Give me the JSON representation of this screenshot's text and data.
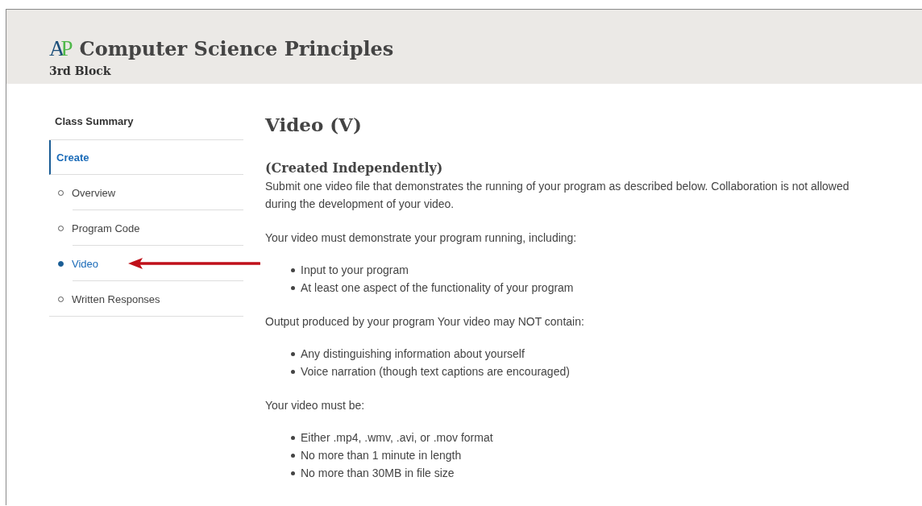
{
  "header": {
    "logo": "AP",
    "title": "Computer Science Principles",
    "subtitle": "3rd Block"
  },
  "sidebar": {
    "items": [
      {
        "label": "Class Summary",
        "kind": "heading"
      },
      {
        "label": "Create",
        "kind": "section",
        "selected": true
      },
      {
        "label": "Overview",
        "kind": "sub",
        "selected": false
      },
      {
        "label": "Program Code",
        "kind": "sub",
        "selected": false
      },
      {
        "label": "Video",
        "kind": "sub",
        "selected": true
      },
      {
        "label": "Written Responses",
        "kind": "sub",
        "selected": false
      }
    ]
  },
  "content": {
    "title": "Video (V)",
    "subtitle": "(Created Independently)",
    "blocks": [
      {
        "kind": "paragraph",
        "text": "Submit one video file that demonstrates the running of your program as described below. Collaboration is not allowed during the development of your video."
      },
      {
        "kind": "paragraph",
        "text": "Your video must demonstrate your program running, including:"
      },
      {
        "kind": "list",
        "items": [
          "Input to your program",
          "At least one aspect of the functionality of your program"
        ]
      },
      {
        "kind": "paragraph",
        "text": "Output produced by your program Your video may NOT contain:"
      },
      {
        "kind": "list",
        "items": [
          "Any distinguishing information about yourself",
          "Voice narration (though text captions are encouraged)"
        ]
      },
      {
        "kind": "paragraph",
        "text": "Your video must be:"
      },
      {
        "kind": "list",
        "items": [
          "Either .mp4, .wmv, .avi, or .mov format",
          "No more than 1 minute in length",
          "No more than 30MB in file size"
        ]
      }
    ]
  }
}
